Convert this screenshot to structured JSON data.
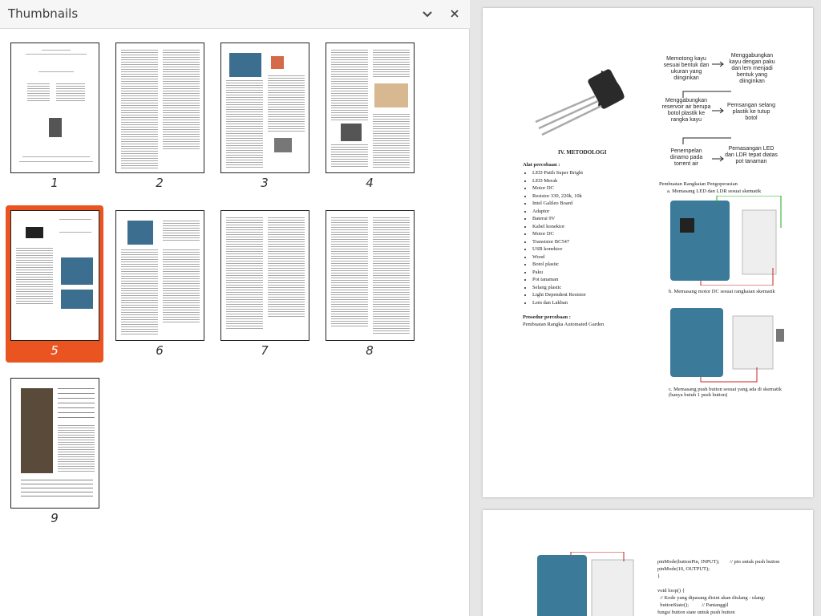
{
  "sidebar": {
    "title": "Thumbnails",
    "collapse_icon": "chevron-down-icon",
    "close_icon": "close-icon"
  },
  "thumbnails": [
    {
      "label": "1"
    },
    {
      "label": "2"
    },
    {
      "label": "3"
    },
    {
      "label": "4"
    },
    {
      "label": "5",
      "selected": true
    },
    {
      "label": "6"
    },
    {
      "label": "7"
    },
    {
      "label": "8"
    },
    {
      "label": "9"
    }
  ],
  "page5": {
    "flow": [
      "Memotong kayu sesuai bentuk dan ukuran yang diinginkan",
      "Menggabungkan kayu dengan paku dan lem menjadi bentuk yang diinginkan",
      "Menggabungkan reservoir air berupa botol plastik ke rangka kayu",
      "Pemsangan selang plastik ke tutup botol",
      "Penempelan dinamo pada torrent air",
      "Pemasangan LED dan LDR tepat diatas pot tanaman"
    ],
    "heading": "IV.   METODOLOGI",
    "tools_title": "Alat percobaan :",
    "tools": [
      "LED Putih Super Bright",
      "LED Merah",
      "Motor DC",
      "Resistor 330, 220k, 10k",
      "Intel Galileo Board",
      "Adaptor",
      "Baterai 9V",
      "Kabel konektor",
      "Motor DC",
      "Transistor BC547",
      "USB konektor",
      "Wood",
      "Botol plastic",
      "Paku",
      "Pot tanaman",
      "Selang plastic",
      "Light Dependent Resistor",
      "Lem dan Lakban"
    ],
    "proc_title": "Prosedur percobaan :",
    "proc_text": "Pembuatan Rangka Automated Garden",
    "circuit_title": "Pembuatan Rangkaian Pengoperasian",
    "step_a": "a.    Memasang LED dan LDR sesuai skematik",
    "step_b": "b.    Memasang motor DC sesuai rangkaian skematik",
    "step_c": "c.    Memasang push button sesuai yang ada di skematik (hanya butuh 1 push button)"
  },
  "page6": {
    "code": [
      "pinMode(buttonPin, INPUT);        // pin untuk push button",
      "pinMode(10, OUTPUT);",
      "}",
      "",
      "void loop() {",
      "  // Kode yang dipasang disini akan diulang - ulang:",
      "  buttonState();          // Pantanggil",
      "fungsi button state untuk push button"
    ]
  }
}
